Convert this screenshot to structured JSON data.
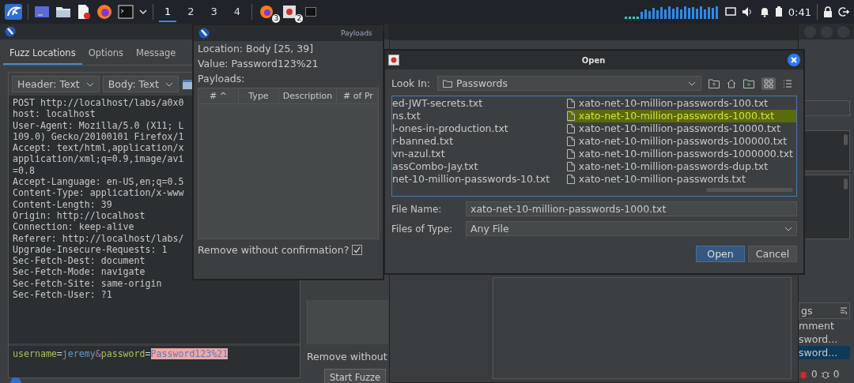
{
  "taskbar": {
    "workspaces": [
      {
        "label": "1",
        "selected": true
      },
      {
        "label": "2",
        "selected": false
      },
      {
        "label": "3",
        "selected": false
      },
      {
        "label": "4",
        "selected": false
      }
    ],
    "tasks": [
      {
        "kind": "browser",
        "badge": "3"
      },
      {
        "kind": "app",
        "badge": "2"
      },
      {
        "kind": "terminal"
      }
    ],
    "clock": "0:41"
  },
  "fuzzer": {
    "tabs": [
      {
        "label": "Fuzz Locations",
        "selected": true
      },
      {
        "label": "Options",
        "selected": false
      },
      {
        "label": "Message",
        "selected": false
      }
    ],
    "header_view": "Header: Text",
    "body_view": "Body: Text",
    "request_lines": [
      "POST http://localhost/labs/a0x0",
      "host: localhost",
      "User-Agent: Mozilla/5.0 (X11; L",
      "109.0) Gecko/20100101 Firefox/1",
      "Accept: text/html,application/x",
      "application/xml;q=0.9,image/avi",
      "=0.8",
      "Accept-Language: en-US,en;q=0.5",
      "Content-Type: application/x-www",
      "Content-Length: 39",
      "Origin: http://localhost",
      "Connection: keep-alive",
      "Referer: http://localhost/labs/",
      "Upgrade-Insecure-Requests: 1",
      "Sec-Fetch-Dest: document",
      "Sec-Fetch-Mode: navigate",
      "Sec-Fetch-Site: same-origin",
      "Sec-Fetch-User: ?1"
    ],
    "body": [
      {
        "kind": "key",
        "text": "username"
      },
      {
        "kind": "sym",
        "text": "="
      },
      {
        "kind": "value",
        "text": "jeremy"
      },
      {
        "kind": "amp",
        "text": "&"
      },
      {
        "kind": "key",
        "text": "password"
      },
      {
        "kind": "sym",
        "text": "="
      },
      {
        "kind": "highlight",
        "text": "Password123%21"
      }
    ],
    "remove_label": "Remove without",
    "start_button": "Start Fuzze",
    "side_header": "gs",
    "side_items": [
      {
        "label": "mment",
        "selected": false
      },
      {
        "label": "sword...",
        "selected": false
      },
      {
        "label": "sword...",
        "selected": true
      }
    ],
    "alert_counts": [
      "0",
      "0"
    ]
  },
  "payloads_dialog": {
    "title": "Payloads",
    "location": "Location: Body [25, 39]",
    "value": "Value: Password123%21",
    "payloads_label": "Payloads:",
    "columns": [
      "# ^",
      "Type",
      "Description",
      "# of Pr"
    ],
    "remove_confirm": {
      "label": "Remove without confirmation?",
      "checked": true
    }
  },
  "open_dialog": {
    "title": "Open",
    "look_in_label": "Look In:",
    "look_in": "Passwords",
    "left_files": [
      {
        "name": "ed-JWT-secrets.txt",
        "selected": false
      },
      {
        "name": "ns.txt",
        "selected": false
      },
      {
        "name": "l-ones-in-production.txt",
        "selected": false
      },
      {
        "name": "r-banned.txt",
        "selected": false
      },
      {
        "name": "vn-azul.txt",
        "selected": false
      },
      {
        "name": "assCombo-Jay.txt",
        "selected": false
      },
      {
        "name": "net-10-million-passwords-10.txt",
        "selected": false
      }
    ],
    "right_files": [
      {
        "name": "xato-net-10-million-passwords-100.txt",
        "selected": false
      },
      {
        "name": "xato-net-10-million-passwords-1000.txt",
        "selected": true
      },
      {
        "name": "xato-net-10-million-passwords-10000.txt",
        "selected": false
      },
      {
        "name": "xato-net-10-million-passwords-100000.txt",
        "selected": false
      },
      {
        "name": "xato-net-10-million-passwords-1000000.txt",
        "selected": false
      },
      {
        "name": "xato-net-10-million-passwords-dup.txt",
        "selected": false
      },
      {
        "name": "xato-net-10-million-passwords.txt",
        "selected": false
      }
    ],
    "file_name_label": "File Name:",
    "file_name": "xato-net-10-million-passwords-1000.txt",
    "file_type_label": "Files of Type:",
    "file_type": "Any File",
    "buttons": [
      {
        "label": "Open",
        "kind": "primary"
      },
      {
        "label": "Cancel",
        "kind": "secondary"
      }
    ]
  }
}
